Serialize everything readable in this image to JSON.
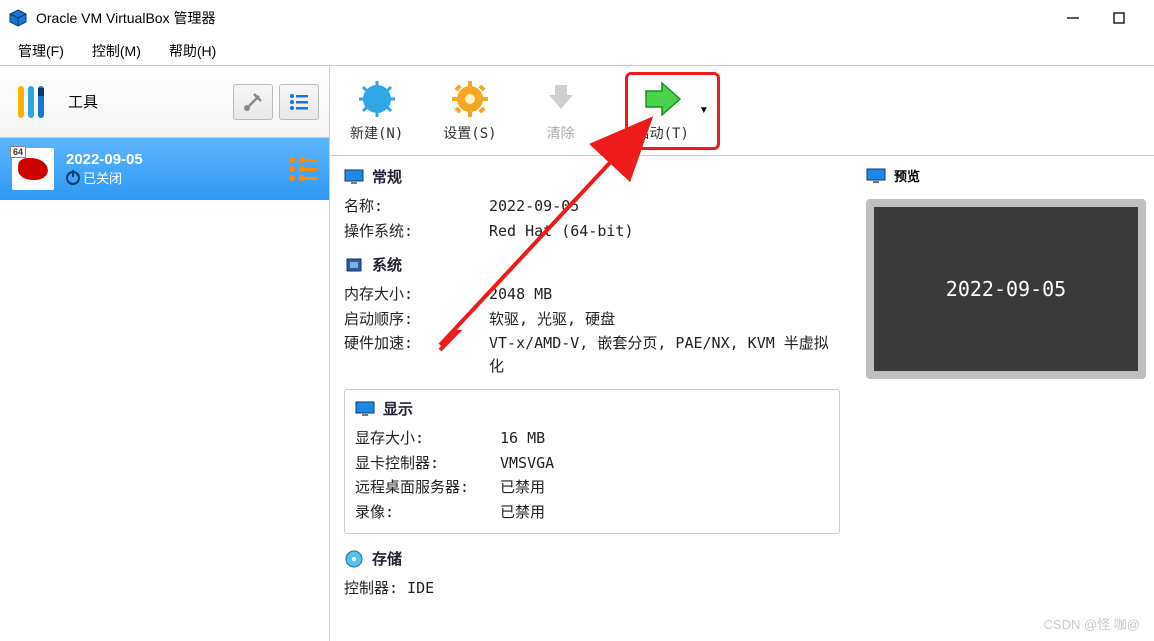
{
  "window": {
    "title": "Oracle VM VirtualBox 管理器"
  },
  "menu": {
    "manage": "管理(F)",
    "control": "控制(M)",
    "help": "帮助(H)"
  },
  "sidebar": {
    "tools_label": "工具",
    "vm": {
      "name": "2022-09-05",
      "state": "已关闭",
      "arch_badge": "64"
    }
  },
  "toolbar": {
    "new_label": "新建(N)",
    "settings_label": "设置(S)",
    "discard_label": "清除",
    "start_label": "启动(T)"
  },
  "details": {
    "general": {
      "title": "常规",
      "name_k": "名称:",
      "name_v": "2022-09-05",
      "os_k": "操作系统:",
      "os_v": "Red Hat (64-bit)"
    },
    "system": {
      "title": "系统",
      "mem_k": "内存大小:",
      "mem_v": "2048 MB",
      "boot_k": "启动顺序:",
      "boot_v": "软驱, 光驱, 硬盘",
      "accel_k": "硬件加速:",
      "accel_v": "VT-x/AMD-V, 嵌套分页, PAE/NX, KVM 半虚拟化"
    },
    "display": {
      "title": "显示",
      "vram_k": "显存大小:",
      "vram_v": "16 MB",
      "ctrl_k": "显卡控制器:",
      "ctrl_v": "VMSVGA",
      "rdp_k": "远程桌面服务器:",
      "rdp_v": "已禁用",
      "rec_k": "录像:",
      "rec_v": "已禁用"
    },
    "storage": {
      "title": "存储",
      "ctrl_k": "控制器: IDE"
    }
  },
  "preview": {
    "title": "预览",
    "vm_name": "2022-09-05"
  },
  "watermark": "CSDN @怪 咖@"
}
